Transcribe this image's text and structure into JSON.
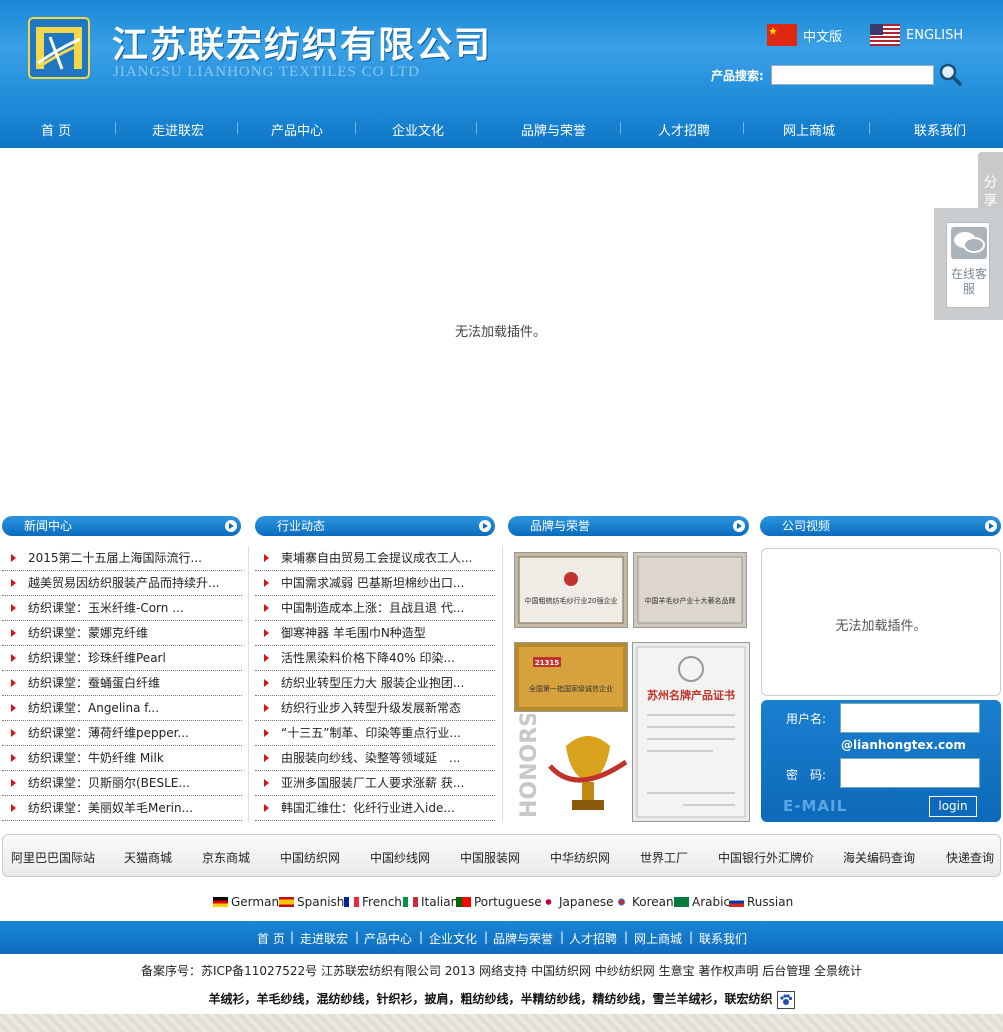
{
  "header": {
    "company_cn": "江苏联宏纺织有限公司",
    "company_en": "JIANGSU LIANHONG TEXTILES CO LTD",
    "lang_cn": "中文版",
    "lang_en": "ENGLISH",
    "search_label": "产品搜索:",
    "search_value": ""
  },
  "nav": [
    "首 页",
    "走进联宏",
    "产品中心",
    "企业文化",
    "品牌与荣誉",
    "人才招聘",
    "网上商城",
    "联系我们"
  ],
  "main": {
    "plugin_message": "无法加载插件。"
  },
  "float": {
    "share": "分享",
    "service": "在线客服"
  },
  "sections": {
    "news": {
      "title": "新闻中心",
      "items": [
        "2015第二十五届上海国际流行...",
        "越美贸易因纺织服装产品而持续升...",
        "纺织课堂：玉米纤维-Corn ...",
        "纺织课堂：蒙娜克纤维",
        "纺织课堂：珍珠纤维Pearl",
        "纺织课堂：蚕蛹蛋白纤维",
        "纺织课堂：Angelina f...",
        "纺织课堂：薄荷纤维pepper...",
        "纺织课堂：牛奶纤维 Milk",
        "纺织课堂：贝斯丽尔(BESLE...",
        "纺织课堂：美丽奴羊毛Merin..."
      ]
    },
    "industry": {
      "title": "行业动态",
      "items": [
        "柬埔寨自由贸易工会提议成衣工人...",
        "中国需求减弱 巴基斯坦棉纱出口...",
        "中国制造成本上涨：且战且退 代...",
        "御寒神器 羊毛围巾N种造型",
        "活性黑染料价格下降40% 印染...",
        "纺织业转型压力大 服装企业抱团...",
        "纺织行业步入转型升级发展新常态",
        "“十三五”制革、印染等重点行业...",
        "由服装向纱线、染整等领域延　...",
        "亚洲多国服装厂工人要求涨薪 获...",
        "韩国汇维仕：化纤行业进入ide..."
      ]
    },
    "honors": {
      "title": "品牌与荣誉",
      "cert1": "中国粗梳纺毛纱行业20强企业",
      "cert2": "中国羊毛纱产业十大著名品牌",
      "cert3_number": "21315",
      "cert3": "全国第一批国家级诚信企业",
      "cert4": "苏州名牌产品证书",
      "watermark": "HONORS"
    },
    "video": {
      "title": "公司视频",
      "plugin_message": "无法加载插件。"
    }
  },
  "login": {
    "username_label": "用户名:",
    "domain": "@lianhongtex.com",
    "password_label": "密　码:",
    "email_mark": "E-MAIL",
    "button": "login"
  },
  "links": [
    "阿里巴巴国际站",
    "天猫商城",
    "京东商城",
    "中国纺织网",
    "中国纱线网",
    "中国服装网",
    "中华纺织网",
    "世界工厂",
    "中国银行外汇牌价",
    "海关编码查询",
    "快递查询"
  ],
  "languages": [
    "German",
    "Spanish",
    "French",
    "Italian",
    "Portuguese",
    "Japanese",
    "Korean",
    "Arabic",
    "Russian"
  ],
  "footer_nav": [
    "首 页",
    "|",
    "走进联宏",
    "|",
    "产品中心",
    "|",
    "企业文化",
    "|",
    "品牌与荣誉",
    "|",
    "人才招聘",
    "|",
    "网上商城",
    "|",
    "联系我们"
  ],
  "footer": {
    "copyright": "备案序号：苏ICP备11027522号 江苏联宏纺织有限公司 2013 网络支持 中国纺织网 中纱纺织网 生意宝 著作权声明  后台管理 全景统计",
    "keywords": "羊绒衫，羊毛纱线，混纺纱线，针织衫，披肩，粗纺纱线，半精纺纱线，精纺纱线，雪兰羊绒衫，联宏纺织"
  }
}
